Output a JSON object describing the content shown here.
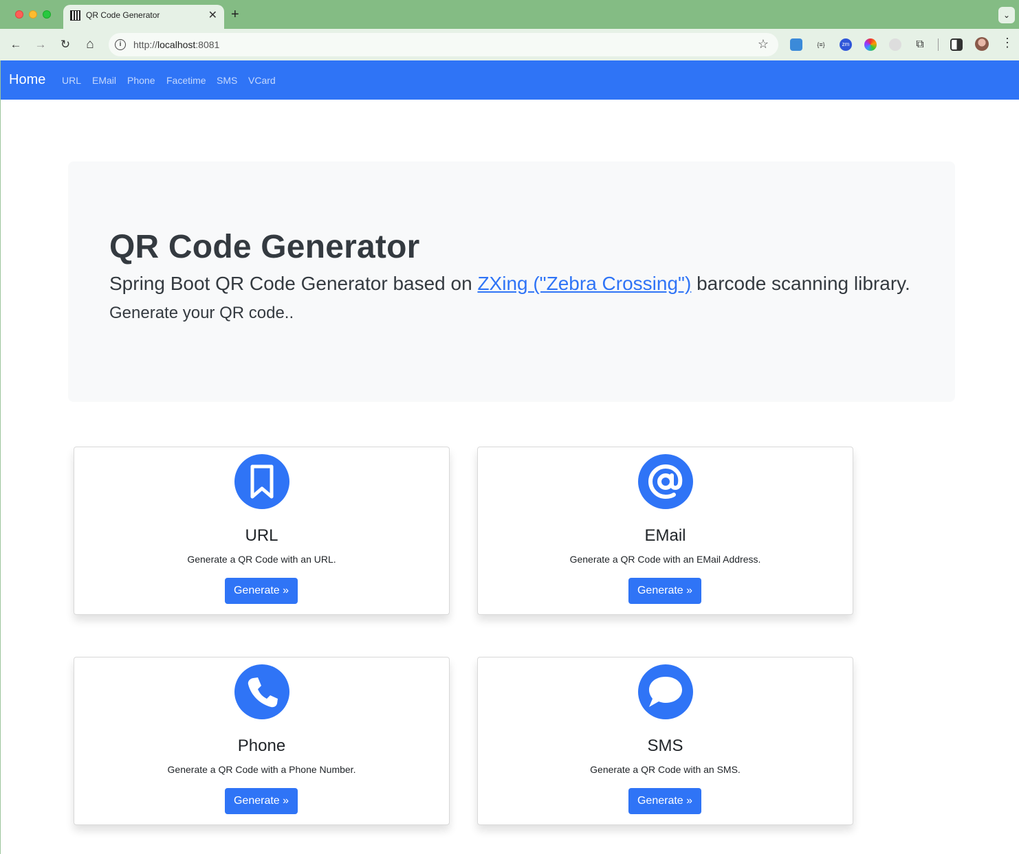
{
  "browser": {
    "tab_title": "QR Code Generator",
    "tab_close": "✕",
    "new_tab": "+",
    "tab_menu": "⌄",
    "url_scheme": "http://",
    "url_host": "localhost",
    "url_port": ":8081",
    "back": "←",
    "forward": "→",
    "reload": "↻",
    "home": "⌂",
    "star": "☆",
    "kebab": "⋮"
  },
  "navbar": {
    "brand": "Home",
    "links": [
      "URL",
      "EMail",
      "Phone",
      "Facetime",
      "SMS",
      "VCard"
    ]
  },
  "hero": {
    "title": "QR Code Generator",
    "lead_before": "Spring Boot QR Code Generator based on ",
    "lead_link": "ZXing (\"Zebra Crossing\")",
    "lead_after": " barcode scanning library.",
    "subtitle": "Generate your QR code.."
  },
  "cards": [
    {
      "icon": "bookmark-icon",
      "title": "URL",
      "text": "Generate a QR Code with an URL.",
      "button": "Generate »"
    },
    {
      "icon": "at-sign-icon",
      "title": "EMail",
      "text": "Generate a QR Code with an EMail Address.",
      "button": "Generate »"
    },
    {
      "icon": "phone-icon",
      "title": "Phone",
      "text": "Generate a QR Code with a Phone Number.",
      "button": "Generate »"
    },
    {
      "icon": "chat-bubble-icon",
      "title": "SMS",
      "text": "Generate a QR Code with an SMS.",
      "button": "Generate »"
    }
  ],
  "colors": {
    "accent": "#2f74f6",
    "jumbotron_bg": "#f8f9fa",
    "browser_frame": "#84bc84"
  }
}
